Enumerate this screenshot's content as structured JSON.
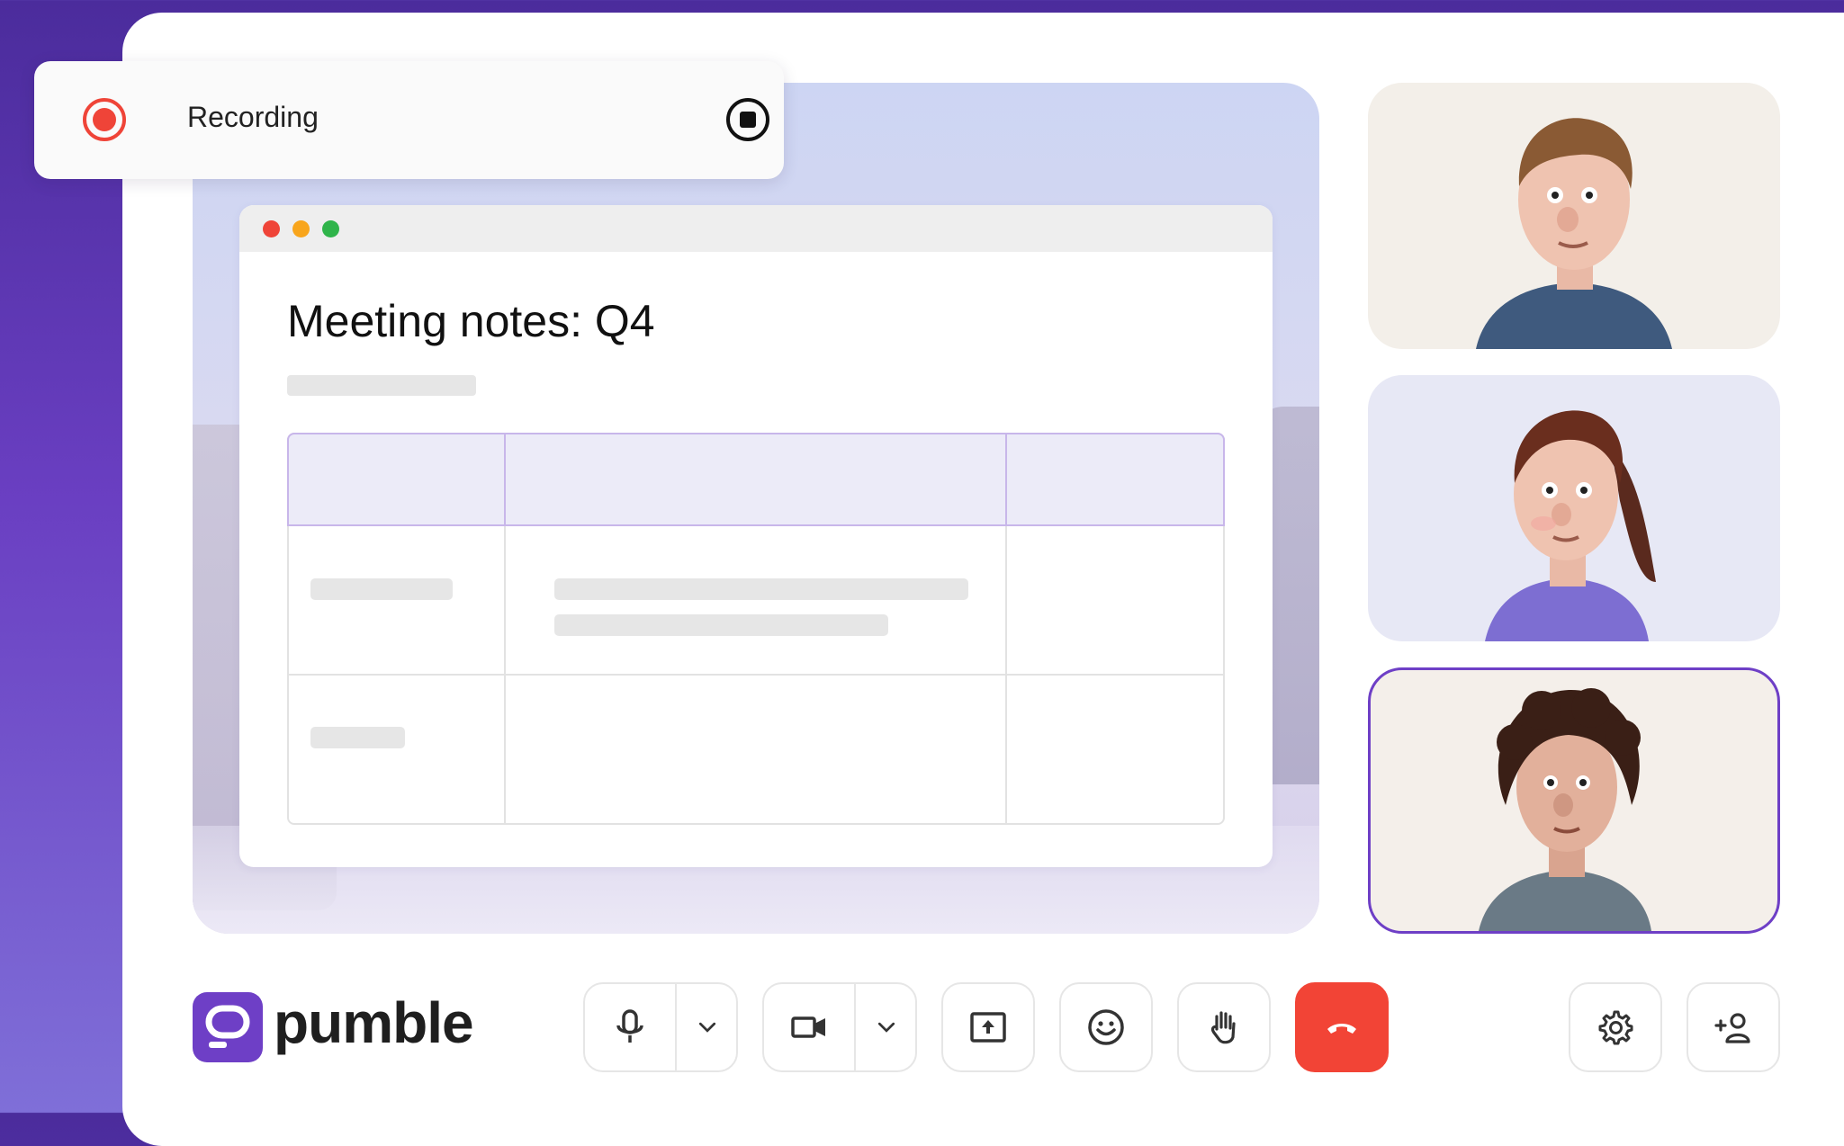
{
  "recording": {
    "label": "Recording",
    "indicator_color": "#ef4438"
  },
  "document": {
    "title": "Meeting notes: Q4"
  },
  "participants": [
    {
      "avatar": "participant-avatar-man"
    },
    {
      "avatar": "participant-avatar-woman"
    },
    {
      "avatar": "participant-avatar-curly",
      "active": true
    }
  ],
  "brand": {
    "name": "pumble",
    "accent": "#6e3fc6"
  },
  "controls": {
    "microphone": "microphone-icon",
    "camera": "camera-icon",
    "share_screen": "share-screen-icon",
    "reactions": "emoji-icon",
    "raise_hand": "raise-hand-icon",
    "hang_up": "hang-up-icon",
    "settings": "gear-icon",
    "add_participant": "add-person-icon",
    "hang_up_color": "#f24436"
  }
}
